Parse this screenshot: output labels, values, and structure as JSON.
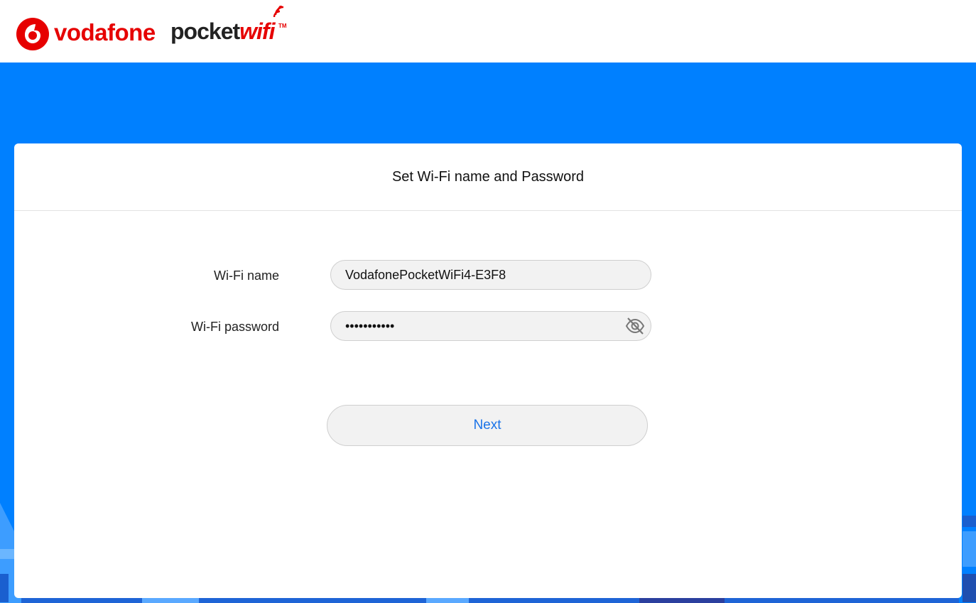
{
  "header": {
    "brand_name": "vodafone",
    "product_prefix": "pocket",
    "product_suffix": "wifi",
    "trademark": "TM",
    "brand_color": "#e60000"
  },
  "theme": {
    "hero_color": "#0080ff",
    "accent_text": "#1a73e8"
  },
  "dialog": {
    "title": "Set Wi-Fi name and Password",
    "wifi_name": {
      "label": "Wi-Fi name",
      "value": "VodafonePocketWiFi4-E3F8"
    },
    "wifi_password": {
      "label": "Wi-Fi password",
      "value": "•••••••••••",
      "toggle_icon": "eye-off-icon"
    },
    "next_label": "Next"
  }
}
